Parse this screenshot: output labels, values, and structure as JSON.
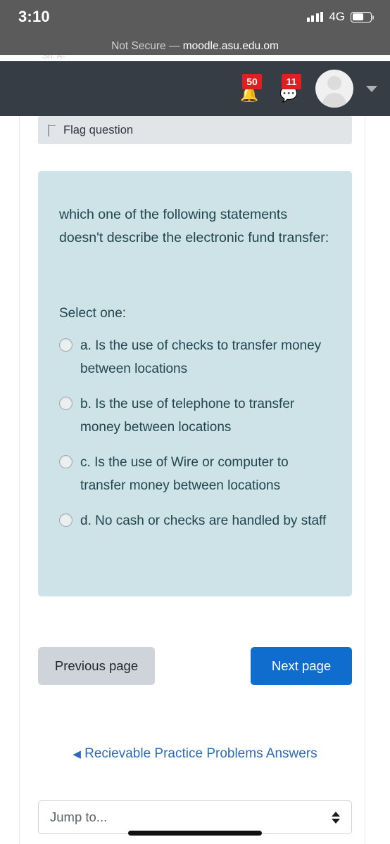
{
  "status_bar": {
    "time": "3:10",
    "network": "4G",
    "signal_icon": "signal-bars-icon",
    "battery_icon": "battery-icon",
    "battery_level": 62
  },
  "browser": {
    "security_label": "Not Secure —",
    "host": "moodle.asu.edu.om",
    "peek_text": "Sh.                                           A-"
  },
  "navbar": {
    "notifications": {
      "icon": "bell-icon",
      "badge": "50"
    },
    "messages": {
      "icon": "message-icon",
      "badge": "11"
    },
    "avatar": "user-avatar-icon",
    "menu_caret": "chevron-down-icon",
    "background_color": "#373d45",
    "badge_color": "#e02020"
  },
  "quiz": {
    "flag": {
      "icon": "flag-icon",
      "label": "Flag question"
    },
    "question_text": "which one of the following statements doesn't describe the electronic fund transfer:",
    "select_prompt": "Select one:",
    "card_color": "#cee3e8",
    "options": [
      {
        "key": "a.",
        "text": "Is the use of checks to transfer money between locations",
        "selected": false
      },
      {
        "key": "b.",
        "text": "Is the use of telephone to transfer money between locations",
        "selected": false
      },
      {
        "key": "c.",
        "text": "Is the use of Wire or computer to transfer money between locations",
        "selected": false
      },
      {
        "key": "d.",
        "text": "No cash or checks are handled by staff",
        "selected": false
      }
    ]
  },
  "navigation": {
    "previous_label": "Previous page",
    "next_label": "Next page",
    "next_color": "#0f6ecd",
    "previous_color": "#ced4da",
    "activity_link_arrow": "◀",
    "activity_link": "Recievable Practice Problems Answers",
    "link_color": "#2b6cb8",
    "jump_to_label": "Jump to...",
    "jump_to_icon": "stepper-arrows-icon"
  }
}
